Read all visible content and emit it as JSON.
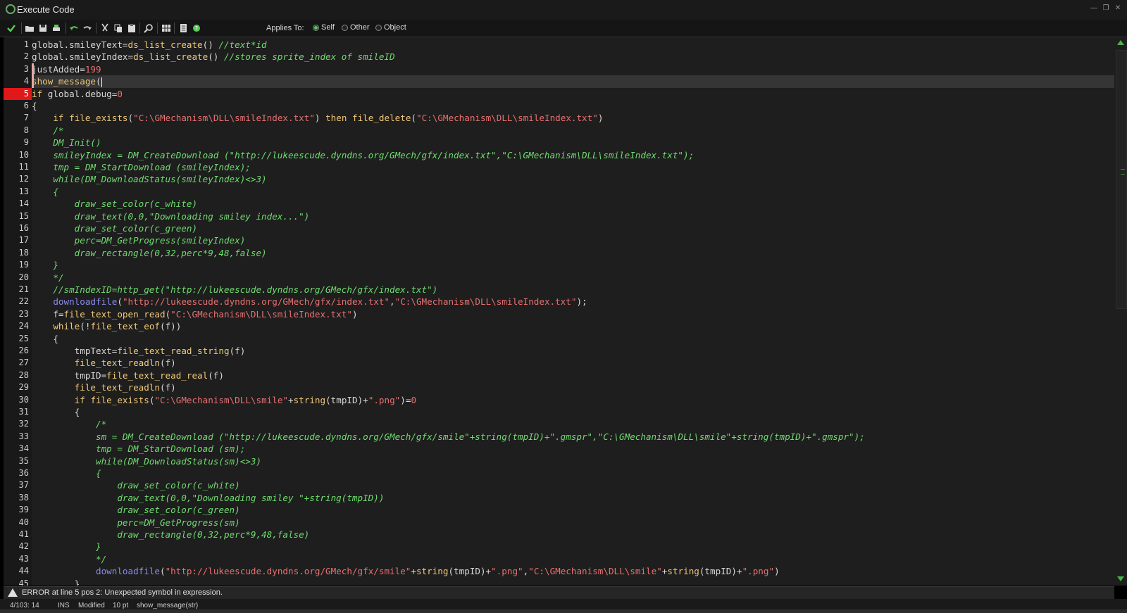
{
  "window": {
    "title": "Execute Code"
  },
  "toolbar": {
    "applies_label": "Applies To:",
    "options": [
      {
        "label": "Self",
        "selected": true
      },
      {
        "label": "Other",
        "selected": false
      },
      {
        "label": "Object",
        "selected": false
      }
    ]
  },
  "editor": {
    "current_line": 4,
    "error_line": 5,
    "lines": [
      [
        [
          "pl",
          "global.smileyText="
        ],
        [
          "fn",
          "ds_list_create"
        ],
        [
          "pl",
          "() "
        ],
        [
          "cmt",
          "//text*id"
        ]
      ],
      [
        [
          "pl",
          "global.smileyIndex="
        ],
        [
          "fn",
          "ds_list_create"
        ],
        [
          "pl",
          "() "
        ],
        [
          "cmt",
          "//stores sprite_index of smileID"
        ]
      ],
      [
        [
          "pl",
          "justAdded="
        ],
        [
          "num",
          "199"
        ]
      ],
      [
        [
          "fn",
          "show_message"
        ],
        [
          "pl",
          "("
        ]
      ],
      [
        [
          "kw",
          "if"
        ],
        [
          "pl",
          " global.debug="
        ],
        [
          "num",
          "0"
        ]
      ],
      [
        [
          "pl",
          "{"
        ]
      ],
      [
        [
          "pl",
          "    "
        ],
        [
          "kw",
          "if"
        ],
        [
          "pl",
          " "
        ],
        [
          "fn",
          "file_exists"
        ],
        [
          "pl",
          "("
        ],
        [
          "str",
          "\"C:\\GMechanism\\DLL\\smileIndex.txt\""
        ],
        [
          "pl",
          ") "
        ],
        [
          "kw",
          "then"
        ],
        [
          "pl",
          " "
        ],
        [
          "fn",
          "file_delete"
        ],
        [
          "pl",
          "("
        ],
        [
          "str",
          "\"C:\\GMechanism\\DLL\\smileIndex.txt\""
        ],
        [
          "pl",
          ")"
        ]
      ],
      [
        [
          "cmt",
          "    /*"
        ]
      ],
      [
        [
          "cmt",
          "    DM_Init()"
        ]
      ],
      [
        [
          "cmt",
          "    smileyIndex = DM_CreateDownload (\"http://lukeescude.dyndns.org/GMech/gfx/index.txt\",\"C:\\GMechanism\\DLL\\smileIndex.txt\");"
        ]
      ],
      [
        [
          "cmt",
          "    tmp = DM_StartDownload (smileyIndex);"
        ]
      ],
      [
        [
          "cmt",
          "    while(DM_DownloadStatus(smileyIndex)<>3)"
        ]
      ],
      [
        [
          "cmt",
          "    {"
        ]
      ],
      [
        [
          "cmt",
          "        draw_set_color(c_white)"
        ]
      ],
      [
        [
          "cmt",
          "        draw_text(0,0,\"Downloading smiley index...\")"
        ]
      ],
      [
        [
          "cmt",
          "        draw_set_color(c_green)"
        ]
      ],
      [
        [
          "cmt",
          "        perc=DM_GetProgress(smileyIndex)"
        ]
      ],
      [
        [
          "cmt",
          "        draw_rectangle(0,32,perc*9,48,false)"
        ]
      ],
      [
        [
          "cmt",
          "    }"
        ]
      ],
      [
        [
          "cmt",
          "    */"
        ]
      ],
      [
        [
          "cmt",
          "    //smIndexID=http_get(\"http://lukeescude.dyndns.org/GMech/gfx/index.txt\")"
        ]
      ],
      [
        [
          "pl",
          "    "
        ],
        [
          "sc",
          "downloadfile"
        ],
        [
          "pl",
          "("
        ],
        [
          "str",
          "\"http://lukeescude.dyndns.org/GMech/gfx/index.txt\""
        ],
        [
          "pl",
          ","
        ],
        [
          "str",
          "\"C:\\GMechanism\\DLL\\smileIndex.txt\""
        ],
        [
          "pl",
          ");"
        ]
      ],
      [
        [
          "pl",
          "    f="
        ],
        [
          "fn",
          "file_text_open_read"
        ],
        [
          "pl",
          "("
        ],
        [
          "str",
          "\"C:\\GMechanism\\DLL\\smileIndex.txt\""
        ],
        [
          "pl",
          ")"
        ]
      ],
      [
        [
          "pl",
          "    "
        ],
        [
          "kw",
          "while"
        ],
        [
          "pl",
          "(!"
        ],
        [
          "fn",
          "file_text_eof"
        ],
        [
          "pl",
          "(f))"
        ]
      ],
      [
        [
          "pl",
          "    {"
        ]
      ],
      [
        [
          "pl",
          "        tmpText="
        ],
        [
          "fn",
          "file_text_read_string"
        ],
        [
          "pl",
          "(f)"
        ]
      ],
      [
        [
          "pl",
          "        "
        ],
        [
          "fn",
          "file_text_readln"
        ],
        [
          "pl",
          "(f)"
        ]
      ],
      [
        [
          "pl",
          "        tmpID="
        ],
        [
          "fn",
          "file_text_read_real"
        ],
        [
          "pl",
          "(f)"
        ]
      ],
      [
        [
          "pl",
          "        "
        ],
        [
          "fn",
          "file_text_readln"
        ],
        [
          "pl",
          "(f)"
        ]
      ],
      [
        [
          "pl",
          "        "
        ],
        [
          "kw",
          "if"
        ],
        [
          "pl",
          " "
        ],
        [
          "fn",
          "file_exists"
        ],
        [
          "pl",
          "("
        ],
        [
          "str",
          "\"C:\\GMechanism\\DLL\\smile\""
        ],
        [
          "pl",
          "+"
        ],
        [
          "fn",
          "string"
        ],
        [
          "pl",
          "(tmpID)+"
        ],
        [
          "str",
          "\".png\""
        ],
        [
          "pl",
          ")="
        ],
        [
          "num",
          "0"
        ]
      ],
      [
        [
          "pl",
          "        {"
        ]
      ],
      [
        [
          "cmt",
          "            /*"
        ]
      ],
      [
        [
          "cmt",
          "            sm = DM_CreateDownload (\"http://lukeescude.dyndns.org/GMech/gfx/smile\"+string(tmpID)+\".gmspr\",\"C:\\GMechanism\\DLL\\smile\"+string(tmpID)+\".gmspr\");"
        ]
      ],
      [
        [
          "cmt",
          "            tmp = DM_StartDownload (sm);"
        ]
      ],
      [
        [
          "cmt",
          "            while(DM_DownloadStatus(sm)<>3)"
        ]
      ],
      [
        [
          "cmt",
          "            {"
        ]
      ],
      [
        [
          "cmt",
          "                draw_set_color(c_white)"
        ]
      ],
      [
        [
          "cmt",
          "                draw_text(0,0,\"Downloading smiley \"+string(tmpID))"
        ]
      ],
      [
        [
          "cmt",
          "                draw_set_color(c_green)"
        ]
      ],
      [
        [
          "cmt",
          "                perc=DM_GetProgress(sm)"
        ]
      ],
      [
        [
          "cmt",
          "                draw_rectangle(0,32,perc*9,48,false)"
        ]
      ],
      [
        [
          "cmt",
          "            }"
        ]
      ],
      [
        [
          "cmt",
          "            */"
        ]
      ],
      [
        [
          "pl",
          "            "
        ],
        [
          "sc",
          "downloadfile"
        ],
        [
          "pl",
          "("
        ],
        [
          "str",
          "\"http://lukeescude.dyndns.org/GMech/gfx/smile\""
        ],
        [
          "pl",
          "+"
        ],
        [
          "fn",
          "string"
        ],
        [
          "pl",
          "(tmpID)+"
        ],
        [
          "str",
          "\".png\""
        ],
        [
          "pl",
          ","
        ],
        [
          "str",
          "\"C:\\GMechanism\\DLL\\smile\""
        ],
        [
          "pl",
          "+"
        ],
        [
          "fn",
          "string"
        ],
        [
          "pl",
          "(tmpID)+"
        ],
        [
          "str",
          "\".png\""
        ],
        [
          "pl",
          ")"
        ]
      ],
      [
        [
          "pl",
          "        }"
        ]
      ]
    ]
  },
  "error": {
    "message": "ERROR at line 5 pos 2: Unexpected symbol in expression."
  },
  "status": {
    "position": "4/103: 14",
    "mode": "INS",
    "state": "Modified",
    "font_size": "10 pt",
    "hint": "show_message(str)"
  },
  "colors": {
    "function": "#f0c878",
    "string": "#e87070",
    "comment": "#6fdc6f",
    "script": "#8a8af0",
    "error_line": "#e0181a",
    "accent_green": "#4ab34a"
  }
}
